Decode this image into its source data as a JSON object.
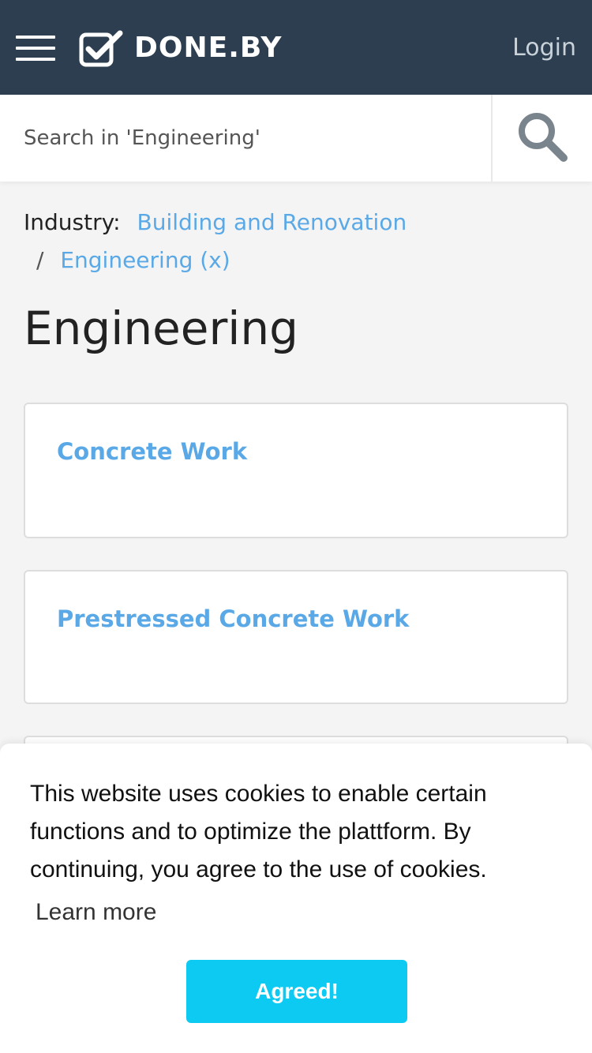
{
  "header": {
    "brand": "DONE.BY",
    "login_label": "Login",
    "menu_icon": "hamburger-menu-icon",
    "logo_icon": "checkbox-check-icon",
    "background": "#2c3e50"
  },
  "search": {
    "placeholder": "Search in 'Engineering'",
    "value": "",
    "icon": "search-icon"
  },
  "breadcrumb": {
    "prefix": "Industry:",
    "items": [
      {
        "label": "Building and Renovation"
      },
      {
        "separator": "/",
        "label": "Engineering (x)"
      }
    ]
  },
  "page": {
    "title": "Engineering"
  },
  "cards": [
    {
      "title": "Concrete Work"
    },
    {
      "title": "Prestressed Concrete Work"
    }
  ],
  "cookie_banner": {
    "message": "This website uses cookies to enable certain functions and to optimize the plattform. By continuing, you agree to the use of cookies.",
    "learn_more": "Learn more",
    "button_label": "Agreed!",
    "button_color": "#0ccaf2"
  },
  "colors": {
    "link": "#5aa9e6",
    "page_background": "#f4f4f4"
  }
}
